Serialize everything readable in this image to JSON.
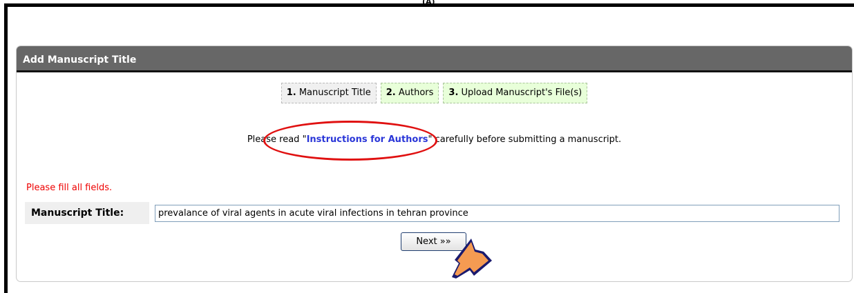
{
  "top_mark": "(A)",
  "panel": {
    "title": "Add Manuscript Title",
    "steps": [
      {
        "num": "1.",
        "label": "Manuscript Title"
      },
      {
        "num": "2.",
        "label": "Authors"
      },
      {
        "num": "3.",
        "label": "Upload Manuscript's File(s)"
      }
    ],
    "instructions": {
      "before": "Please read \"",
      "link": "Instructions for Authors",
      "after": "\" carefully before submitting a manuscript."
    },
    "warning": "Please fill all fields.",
    "field": {
      "label": "Manuscript Title:",
      "value": "prevalance of viral agents in acute viral infections in tehran province"
    },
    "next_button": "Next »»"
  },
  "colors": {
    "header_bg": "#676767",
    "link": "#2a36d8",
    "warning": "#ee0000",
    "highlight_ellipse": "#e01010",
    "pointer_arrow": "#f59b52"
  },
  "icons": {
    "pointer": "arrow-pointer-icon"
  }
}
